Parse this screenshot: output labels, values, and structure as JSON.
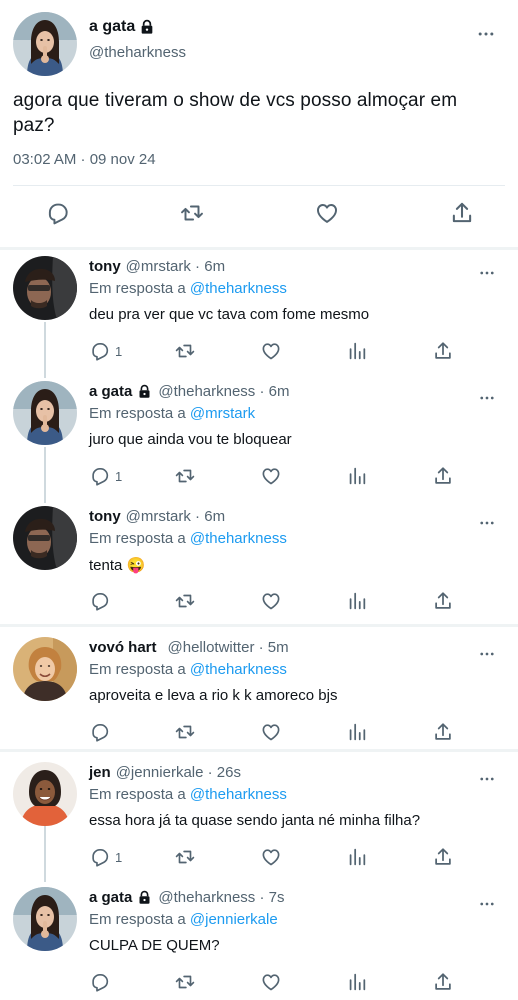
{
  "main_tweet": {
    "name": "a gata",
    "handle": "@theharkness",
    "text": "agora que tiveram o show de vcs posso almoçar em paz?",
    "timestamp": "03:02 AM · 09 nov 24"
  },
  "replies": [
    {
      "name": "tony",
      "handle": "@mrstark · 6m",
      "in_reply_prefix": "Em resposta a",
      "in_reply_to": "@theharkness",
      "text": "deu pra ver que vc tava com fome mesmo",
      "reply_count": "1"
    },
    {
      "name": "a gata",
      "handle": "@theharkness · 6m",
      "in_reply_prefix": "Em resposta a",
      "in_reply_to": "@mrstark",
      "text": "juro que ainda vou te bloquear",
      "reply_count": "1"
    },
    {
      "name": "tony",
      "handle": "@mrstark · 6m",
      "in_reply_prefix": "Em resposta a",
      "in_reply_to": "@theharkness",
      "text": "tenta 😜",
      "reply_count": ""
    },
    {
      "name": "vovó hart",
      "handle": "@hellotwitter · 5m",
      "in_reply_prefix": "Em resposta a",
      "in_reply_to": "@theharkness",
      "text": "aproveita e leva a rio k k amoreco bjs",
      "reply_count": ""
    },
    {
      "name": "jen",
      "handle": "@jennierkale · 26s",
      "in_reply_prefix": "Em resposta a",
      "in_reply_to": "@theharkness",
      "text": "essa hora já ta quase sendo janta né minha filha?",
      "reply_count": "1"
    },
    {
      "name": "a gata",
      "handle": "@theharkness · 7s",
      "in_reply_prefix": "Em resposta a",
      "in_reply_to": "@jennierkale",
      "text": "CULPA DE QUEM?",
      "reply_count": ""
    }
  ],
  "icons": {
    "reply": "reply-icon",
    "retweet": "retweet-icon",
    "like": "heart-icon",
    "views": "views-icon",
    "share": "share-icon",
    "lock": "lock-icon",
    "more": "more-icon"
  },
  "colors": {
    "text": "#0f1419",
    "secondary": "#536471",
    "link": "#1d9bf0",
    "separator": "#eff3f4"
  }
}
